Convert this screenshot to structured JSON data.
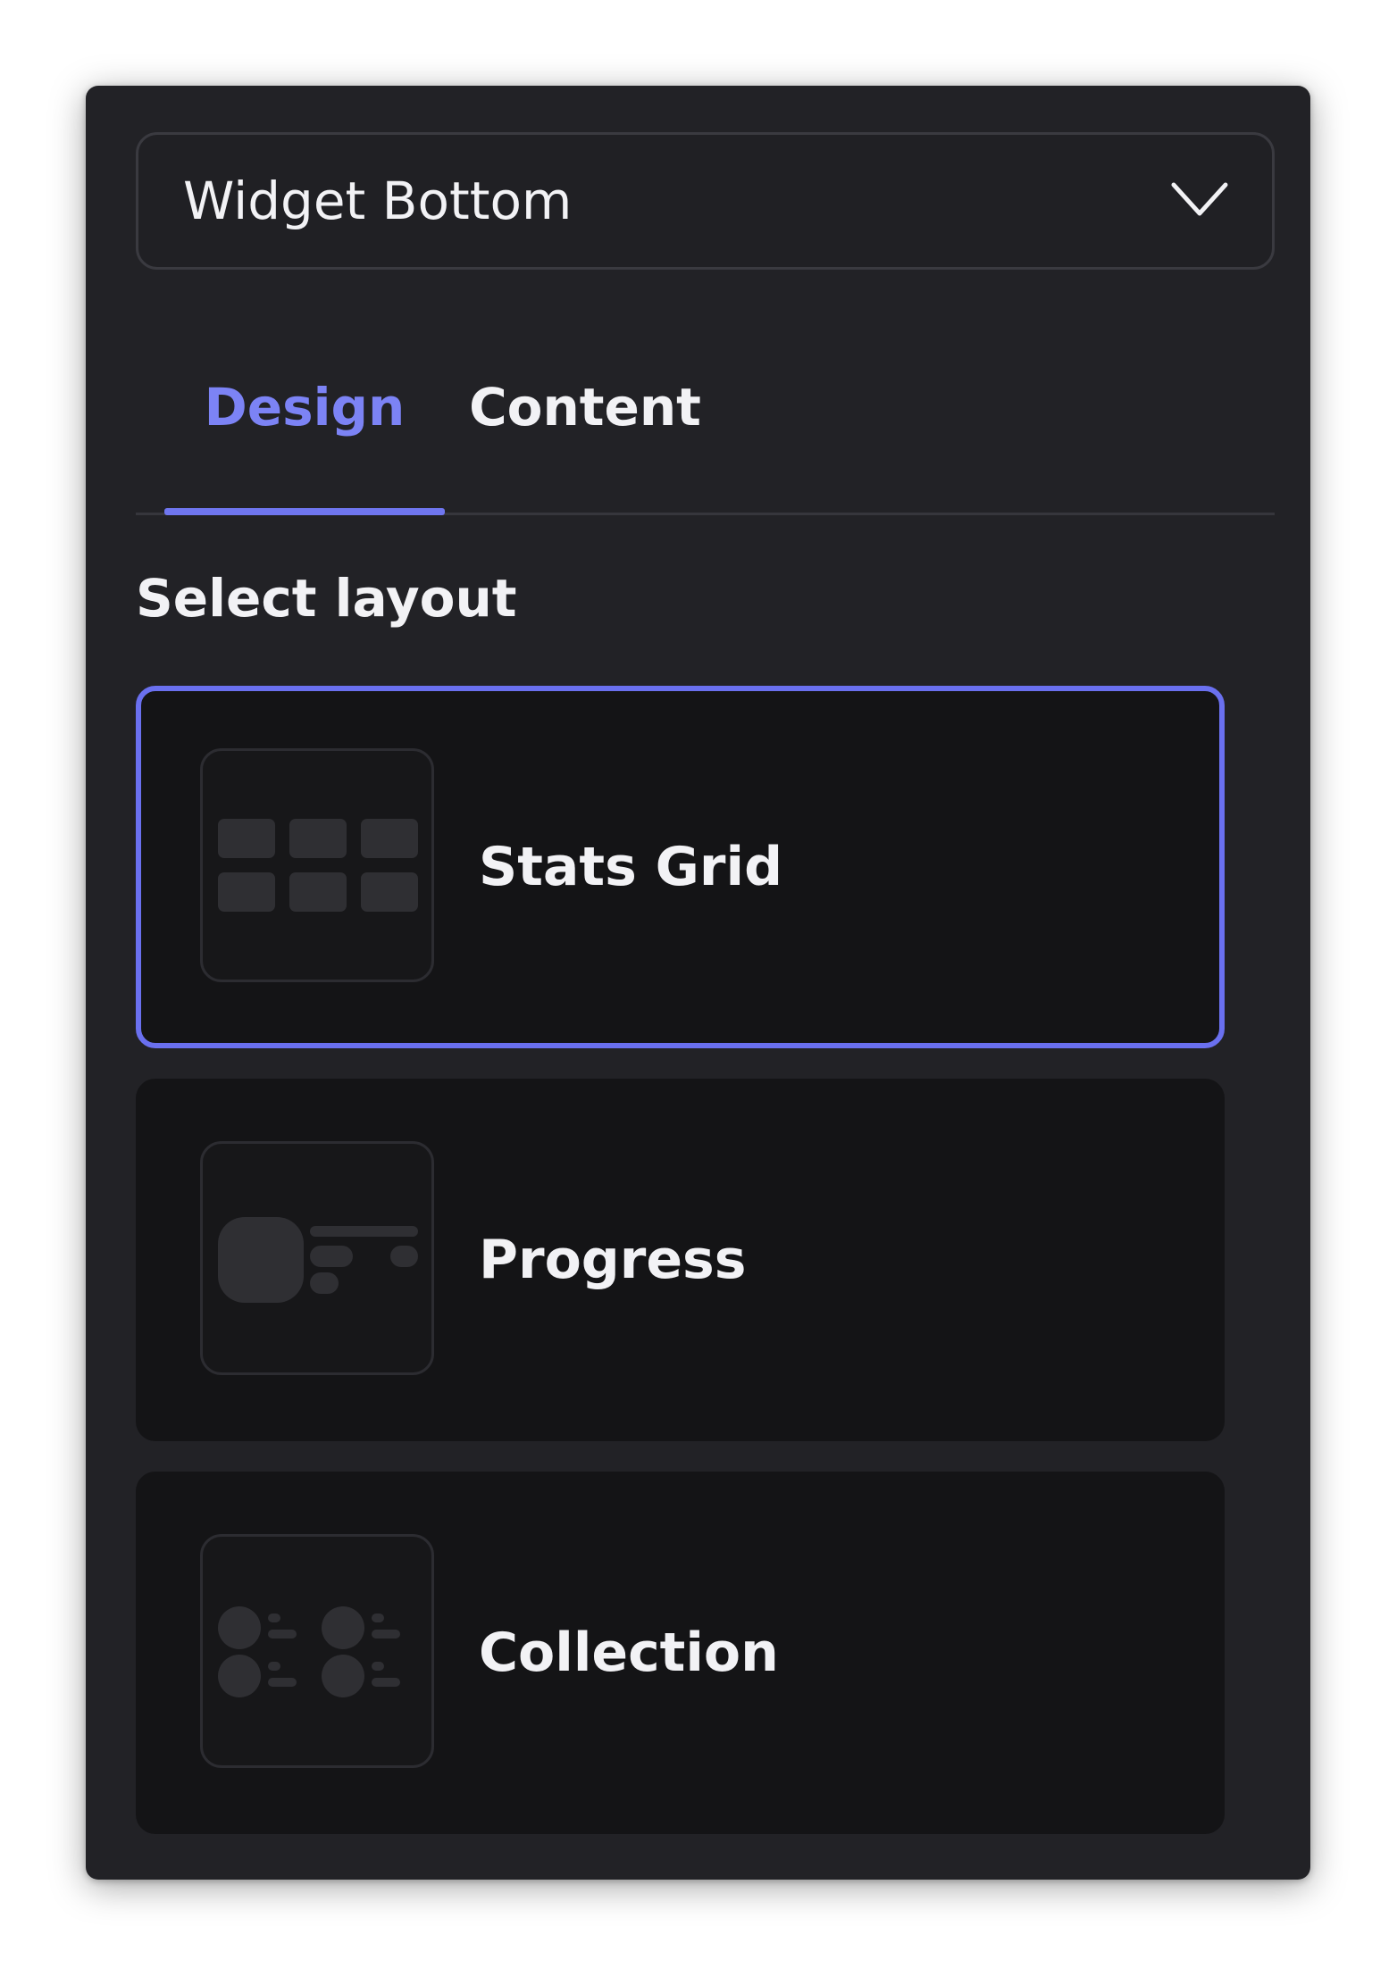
{
  "dropdown": {
    "selected": "Widget Bottom",
    "icon": "chevron-down-icon"
  },
  "tabs": [
    {
      "label": "Design",
      "active": true
    },
    {
      "label": "Content",
      "active": false
    }
  ],
  "section": {
    "title": "Select layout"
  },
  "layouts": [
    {
      "label": "Stats Grid",
      "icon": "stats-grid-icon",
      "selected": true
    },
    {
      "label": "Progress",
      "icon": "progress-layout-icon",
      "selected": false
    },
    {
      "label": "Collection",
      "icon": "collection-layout-icon",
      "selected": false
    }
  ],
  "colors": {
    "panel_bg": "#222226",
    "card_bg": "#141416",
    "accent": "#6f76ef",
    "active_tab_text": "#7c83f5",
    "text": "#f2f2f5",
    "thumb_shape": "#2f2f33"
  }
}
